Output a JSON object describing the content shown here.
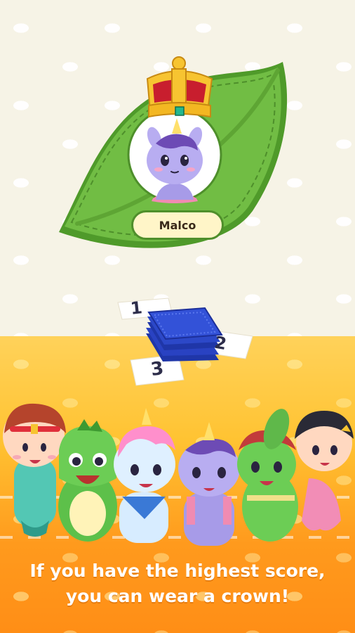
{
  "player": {
    "name": "Malco",
    "award": "crown"
  },
  "cards": {
    "numbers": [
      "1",
      "2",
      "3"
    ]
  },
  "caption": {
    "line1": "If you have the highest score,",
    "line2": "you can wear a crown!"
  },
  "colors": {
    "leaf": "#6cbb3e",
    "floor": "#ffb52a",
    "deck": "#2c48c8",
    "crown": "#f7c431"
  },
  "characters": [
    "boy-hero-icon",
    "green-dragon-icon",
    "blue-unicorn-icon",
    "purple-unicorn-icon",
    "girl-dragon-icon",
    "girl-mermaid-icon"
  ]
}
